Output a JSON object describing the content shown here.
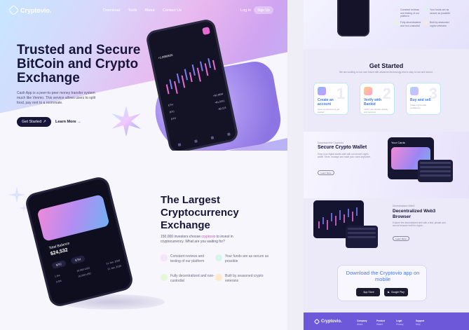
{
  "nav": {
    "brand": "Cryptovio.",
    "links": [
      "Download",
      "Tools",
      "About",
      "Contact Us"
    ],
    "login": "Log in",
    "signup": "Sign Up"
  },
  "hero": {
    "title": "Trusted and Secure BitCoin and Crypto Exchange",
    "description": "Cash App is a peer-to-peer money transfer system much like Venmo. This service allows users to split food, pay rent to a roommate.",
    "get_started": "Get Started",
    "learn_more": "Learn More",
    "phone": {
      "balance": "+1,0880530",
      "rows": [
        [
          "ETH",
          "+$1,9834"
        ],
        [
          "BTC",
          "+$1,0211"
        ],
        [
          "ETH",
          "-$2,113"
        ]
      ]
    }
  },
  "largest": {
    "title": "The Largest Cryptocurrency Exchange",
    "desc_prefix": "150,000 investors choose ",
    "desc_brand": "cryptovio",
    "desc_suffix": " to invest in cryptocurrency. What are you waiting for?",
    "features": [
      "Constant reviews and testing of our platform",
      "Your funds are as secure as possible",
      "Fully decentralized and non-custodial",
      "Built by seasoned crypto veterans"
    ],
    "phone": {
      "balance_label": "Total Balance",
      "balance": "$24,532",
      "coins": [
        "BTC",
        "ETH"
      ],
      "list": [
        [
          "1.5%",
          "10,000 USD",
          "21 Jan, 2020"
        ],
        [
          "3.3%",
          "10,000 USD",
          "21 Jan, 2020"
        ]
      ]
    }
  },
  "right": {
    "features": [
      "Constant reviews and testing of our platform",
      "Your funds are as secure as possible",
      "Fully decentralized and non-custodial",
      "Built by seasoned crypto veterans"
    ],
    "get_started_title": "Get Started",
    "get_started_sub": "We are working on our own future with advanced technology that is easy to use and secure.",
    "steps": [
      {
        "num": "1",
        "title": "Create an account",
        "desc": "Open an account to get started."
      },
      {
        "num": "2",
        "title": "Verify with Bankid",
        "desc": "Verify your identity quickly and securely."
      },
      {
        "num": "3",
        "title": "Buy and sell",
        "desc": "Trade crypto with confidence."
      }
    ],
    "wallet_tag": "Download the Cryptovio",
    "wallet_title": "Secure Crypto Wallet",
    "wallet_desc": "Keep your digital assets safe with our secure crypto wallet. Store, manage and trade your coins anywhere.",
    "wallet_more": "Learn More",
    "cards_label": "Your Cards",
    "browser_tag": "Decentralized Web3",
    "browser_title": "Decentralized Web3 Browser",
    "browser_desc": "Explore the decentralized web with a fast, private and secure browser built for crypto.",
    "browser_more": "Learn More",
    "download_title": "Download the Cryptovio app on mobile",
    "app_store": "App Store",
    "google_play": "Google Play",
    "footer_brand": "Cryptovio.",
    "footer_cols": [
      {
        "head": "Company",
        "items": [
          "About"
        ]
      },
      {
        "head": "Product",
        "items": [
          "Wallet"
        ]
      },
      {
        "head": "Legal",
        "items": [
          "Privacy"
        ]
      },
      {
        "head": "Support",
        "items": [
          "Help"
        ]
      }
    ]
  },
  "colors": {
    "brand_dark": "#17163a",
    "accent_pink": "#c25ab8",
    "accent_blue": "#3c7cf0",
    "footer": "#6d58d9"
  }
}
